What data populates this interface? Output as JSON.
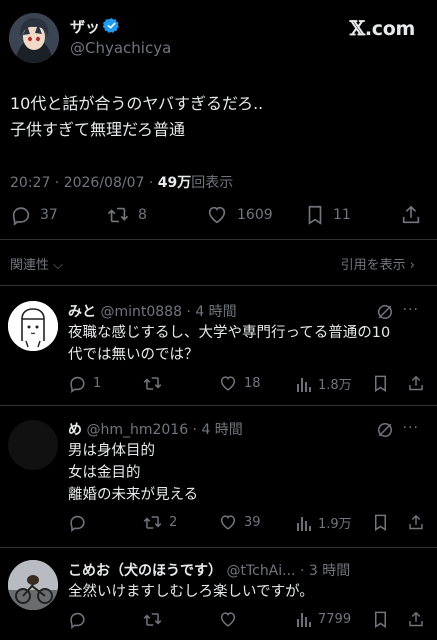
{
  "brand": {
    "logo_text": "𝕏",
    "domain_text": ".com"
  },
  "main_tweet": {
    "author_name": "ザッ",
    "author_handle": "@Chyachicya",
    "text_lines": [
      "10代と話が合うのヤバすぎるだろ..",
      "子供すぎて無理だろ普通"
    ],
    "timestamp": "20:27 · 2026/08/07 · ",
    "views_count": "49万",
    "views_label": "回表示",
    "replies": "37",
    "retweets": "8",
    "likes": "1609",
    "bookmarks": "11",
    "verified_color": "#1d9bf0"
  },
  "related_bar": {
    "left_label": "関連性",
    "right_label": "引用を表示"
  },
  "replies": [
    {
      "name": "みと",
      "handle": "@mint0888 · 4 時間",
      "lines": [
        "夜職な感じするし、大学や専門行ってる普通の10",
        "代では無いのでは？"
      ],
      "reply_count": "1",
      "retweet_count": "",
      "like_count": "18",
      "view_count": "1.8万"
    },
    {
      "name": "め",
      "handle": "@hm_hm2016 · 4 時間",
      "lines": [
        "男は身体目的",
        "女は金目的",
        "離婚の未来が見える"
      ],
      "reply_count": "",
      "retweet_count": "2",
      "like_count": "39",
      "view_count": "1.9万"
    },
    {
      "name": "こめお（犬のほうです）",
      "handle": "@tTchAi... · 3 時間",
      "lines": [
        "全然いけますしむしろ楽しいですが。"
      ],
      "reply_count": "",
      "retweet_count": "",
      "like_count": "",
      "view_count": "7799"
    }
  ]
}
